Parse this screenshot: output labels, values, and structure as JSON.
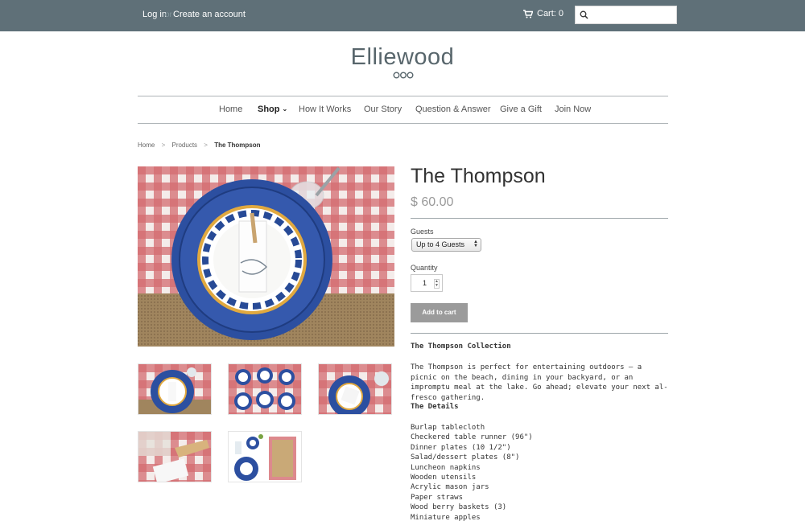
{
  "topbar": {
    "login": "Log in",
    "separator": "or",
    "create_account": "Create an account",
    "cart": "Cart: 0",
    "search_placeholder": ""
  },
  "brand": {
    "name": "Elliewood"
  },
  "nav": {
    "items": [
      {
        "label": "Home"
      },
      {
        "label": "Shop"
      },
      {
        "label": "How It Works"
      },
      {
        "label": "Our Story"
      },
      {
        "label": "Question & Answer"
      },
      {
        "label": "Give a Gift"
      },
      {
        "label": "Join Now"
      }
    ]
  },
  "breadcrumb": {
    "home": "Home",
    "sep": ">",
    "products": "Products",
    "current": "The Thompson"
  },
  "product": {
    "title": "The Thompson",
    "price": "$ 60.00",
    "guests_label": "Guests",
    "guests_value": "Up to 4 Guests",
    "quantity_label": "Quantity",
    "quantity_value": "1",
    "add_to_cart": "Add to cart",
    "collection_heading": "The Thompson Collection",
    "description": "The Thompson is perfect for entertaining outdoors – a picnic on the beach, dining in your backyard, or an impromptu meal at the lake. Go ahead; elevate your next al-fresco gathering.",
    "details_heading": "The Details",
    "details": [
      "Burlap tablecloth",
      "Checkered table runner (96\")",
      "Dinner plates (10 1/2\")",
      "Salad/dessert plates (8\")",
      "Luncheon napkins",
      "Wooden utensils",
      "Acrylic mason jars",
      "Paper straws",
      "Wood berry baskets (3)",
      "Miniature apples"
    ]
  },
  "colors": {
    "topbar": "#5f7078",
    "logo": "#58666c",
    "button": "#9b9b9b",
    "gingham_red": "#c94a4f",
    "plate_blue": "#2c4fa0"
  }
}
